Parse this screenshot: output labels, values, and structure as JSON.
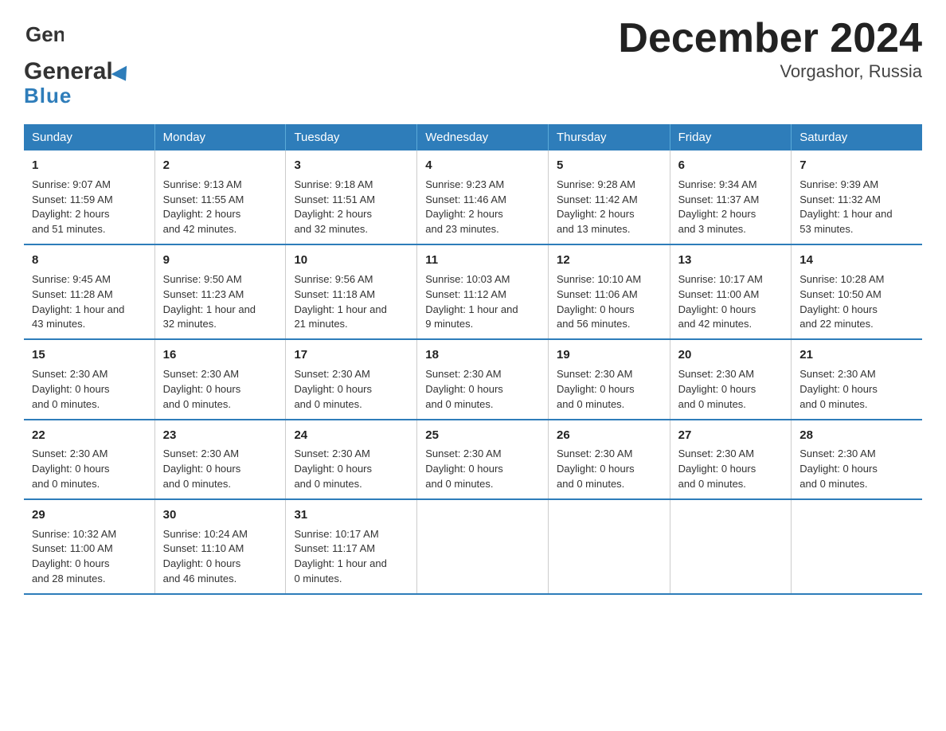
{
  "logo": {
    "general": "General",
    "blue": "Blue"
  },
  "title": "December 2024",
  "subtitle": "Vorgashor, Russia",
  "weekdays": [
    "Sunday",
    "Monday",
    "Tuesday",
    "Wednesday",
    "Thursday",
    "Friday",
    "Saturday"
  ],
  "weeks": [
    [
      {
        "day": "1",
        "info": "Sunrise: 9:07 AM\nSunset: 11:59 AM\nDaylight: 2 hours\nand 51 minutes."
      },
      {
        "day": "2",
        "info": "Sunrise: 9:13 AM\nSunset: 11:55 AM\nDaylight: 2 hours\nand 42 minutes."
      },
      {
        "day": "3",
        "info": "Sunrise: 9:18 AM\nSunset: 11:51 AM\nDaylight: 2 hours\nand 32 minutes."
      },
      {
        "day": "4",
        "info": "Sunrise: 9:23 AM\nSunset: 11:46 AM\nDaylight: 2 hours\nand 23 minutes."
      },
      {
        "day": "5",
        "info": "Sunrise: 9:28 AM\nSunset: 11:42 AM\nDaylight: 2 hours\nand 13 minutes."
      },
      {
        "day": "6",
        "info": "Sunrise: 9:34 AM\nSunset: 11:37 AM\nDaylight: 2 hours\nand 3 minutes."
      },
      {
        "day": "7",
        "info": "Sunrise: 9:39 AM\nSunset: 11:32 AM\nDaylight: 1 hour and\n53 minutes."
      }
    ],
    [
      {
        "day": "8",
        "info": "Sunrise: 9:45 AM\nSunset: 11:28 AM\nDaylight: 1 hour and\n43 minutes."
      },
      {
        "day": "9",
        "info": "Sunrise: 9:50 AM\nSunset: 11:23 AM\nDaylight: 1 hour and\n32 minutes."
      },
      {
        "day": "10",
        "info": "Sunrise: 9:56 AM\nSunset: 11:18 AM\nDaylight: 1 hour and\n21 minutes."
      },
      {
        "day": "11",
        "info": "Sunrise: 10:03 AM\nSunset: 11:12 AM\nDaylight: 1 hour and\n9 minutes."
      },
      {
        "day": "12",
        "info": "Sunrise: 10:10 AM\nSunset: 11:06 AM\nDaylight: 0 hours\nand 56 minutes."
      },
      {
        "day": "13",
        "info": "Sunrise: 10:17 AM\nSunset: 11:00 AM\nDaylight: 0 hours\nand 42 minutes."
      },
      {
        "day": "14",
        "info": "Sunrise: 10:28 AM\nSunset: 10:50 AM\nDaylight: 0 hours\nand 22 minutes."
      }
    ],
    [
      {
        "day": "15",
        "info": "\nSunset: 2:30 AM\nDaylight: 0 hours\nand 0 minutes."
      },
      {
        "day": "16",
        "info": "\nSunset: 2:30 AM\nDaylight: 0 hours\nand 0 minutes."
      },
      {
        "day": "17",
        "info": "\nSunset: 2:30 AM\nDaylight: 0 hours\nand 0 minutes."
      },
      {
        "day": "18",
        "info": "\nSunset: 2:30 AM\nDaylight: 0 hours\nand 0 minutes."
      },
      {
        "day": "19",
        "info": "\nSunset: 2:30 AM\nDaylight: 0 hours\nand 0 minutes."
      },
      {
        "day": "20",
        "info": "\nSunset: 2:30 AM\nDaylight: 0 hours\nand 0 minutes."
      },
      {
        "day": "21",
        "info": "\nSunset: 2:30 AM\nDaylight: 0 hours\nand 0 minutes."
      }
    ],
    [
      {
        "day": "22",
        "info": "\nSunset: 2:30 AM\nDaylight: 0 hours\nand 0 minutes."
      },
      {
        "day": "23",
        "info": "\nSunset: 2:30 AM\nDaylight: 0 hours\nand 0 minutes."
      },
      {
        "day": "24",
        "info": "\nSunset: 2:30 AM\nDaylight: 0 hours\nand 0 minutes."
      },
      {
        "day": "25",
        "info": "\nSunset: 2:30 AM\nDaylight: 0 hours\nand 0 minutes."
      },
      {
        "day": "26",
        "info": "\nSunset: 2:30 AM\nDaylight: 0 hours\nand 0 minutes."
      },
      {
        "day": "27",
        "info": "\nSunset: 2:30 AM\nDaylight: 0 hours\nand 0 minutes."
      },
      {
        "day": "28",
        "info": "\nSunset: 2:30 AM\nDaylight: 0 hours\nand 0 minutes."
      }
    ],
    [
      {
        "day": "29",
        "info": "Sunrise: 10:32 AM\nSunset: 11:00 AM\nDaylight: 0 hours\nand 28 minutes."
      },
      {
        "day": "30",
        "info": "Sunrise: 10:24 AM\nSunset: 11:10 AM\nDaylight: 0 hours\nand 46 minutes."
      },
      {
        "day": "31",
        "info": "Sunrise: 10:17 AM\nSunset: 11:17 AM\nDaylight: 1 hour and\n0 minutes."
      },
      {
        "day": "",
        "info": ""
      },
      {
        "day": "",
        "info": ""
      },
      {
        "day": "",
        "info": ""
      },
      {
        "day": "",
        "info": ""
      }
    ]
  ]
}
